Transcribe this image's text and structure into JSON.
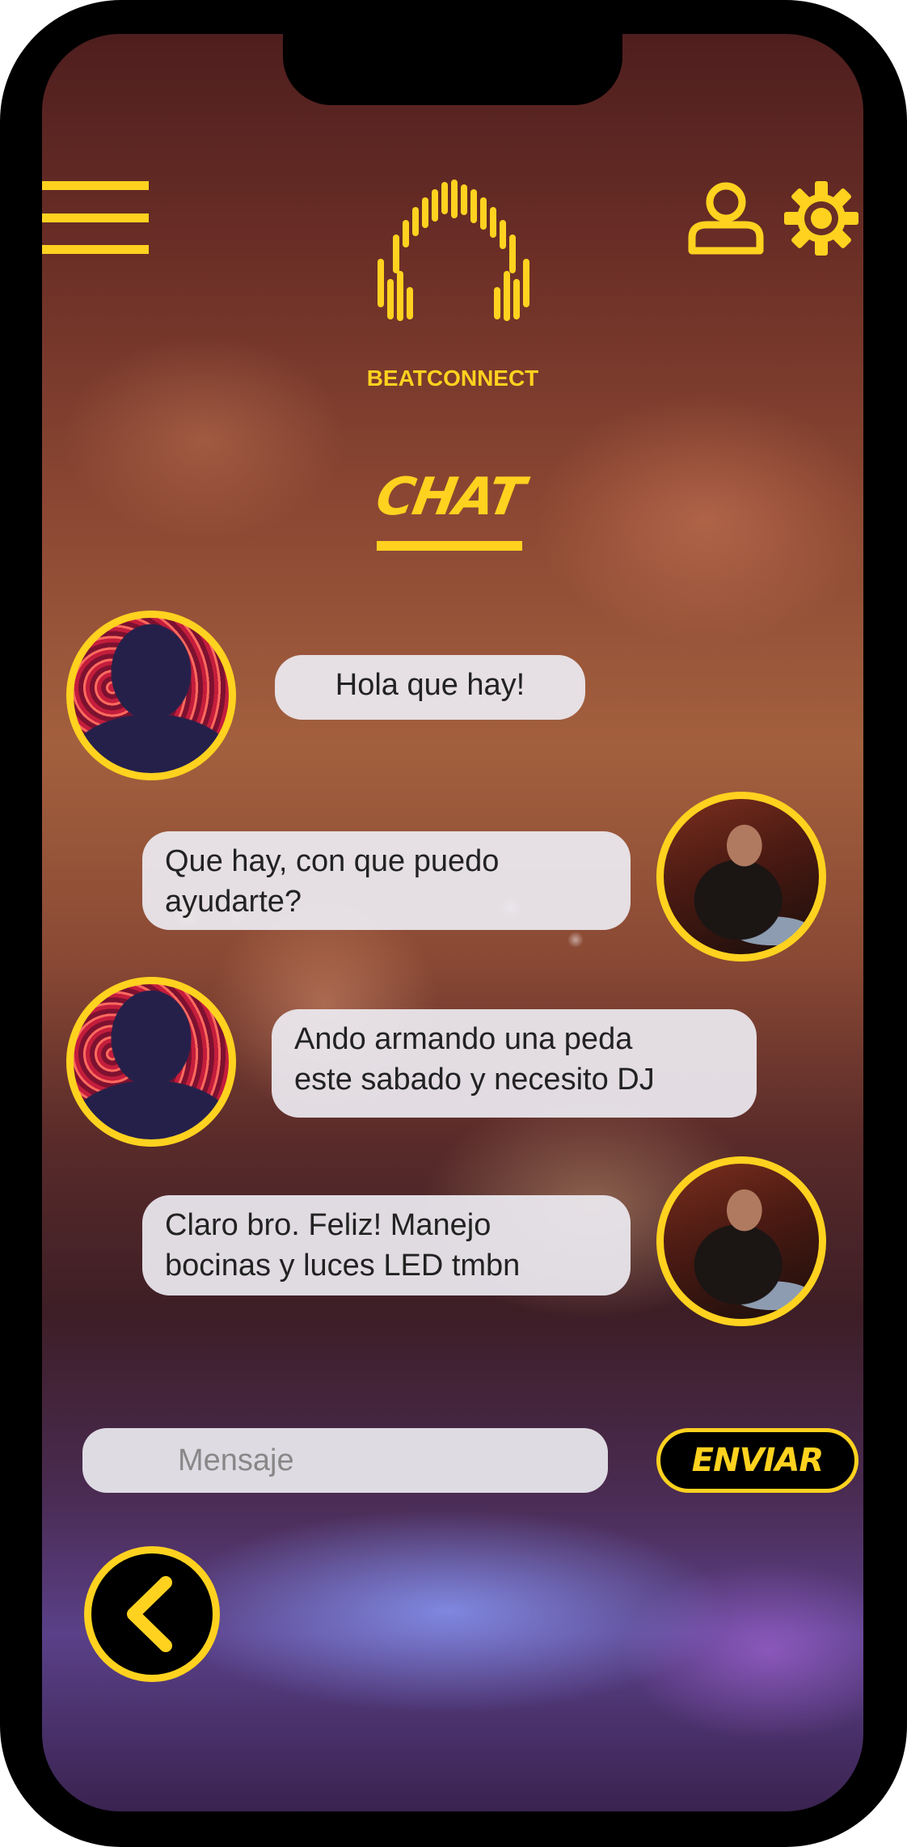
{
  "app": {
    "brand_name": "BEATCONNECT",
    "page_title": "CHAT",
    "accent_color": "#ffd21f"
  },
  "header": {
    "menu_icon": "hamburger-menu-icon",
    "logo_icon": "headphones-equalizer-logo",
    "profile_icon": "user-icon",
    "settings_icon": "gear-icon"
  },
  "messages": [
    {
      "sender": "client",
      "text": "Hola que hay!"
    },
    {
      "sender": "dj",
      "text": "Que hay, con que puedo\nayudarte?"
    },
    {
      "sender": "client",
      "text": "Ando armando una peda\neste sabado y necesito DJ"
    },
    {
      "sender": "dj",
      "text": "Claro bro. Feliz! Manejo\nbocinas y luces LED tmbn"
    }
  ],
  "composer": {
    "placeholder": "Mensaje",
    "send_label": "ENVIAR"
  },
  "navigation": {
    "back_icon": "chevron-left-icon"
  }
}
